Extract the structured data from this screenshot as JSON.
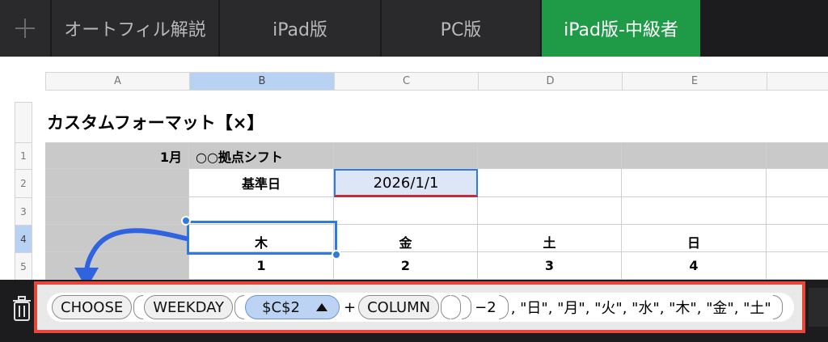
{
  "tabs": [
    {
      "label": "オートフィル解説",
      "active": false
    },
    {
      "label": "iPad版",
      "active": false
    },
    {
      "label": "PC版",
      "active": false
    },
    {
      "label": "iPad版-中級者",
      "active": true
    }
  ],
  "columns": [
    "A",
    "B",
    "C",
    "D",
    "E"
  ],
  "rows": [
    "1",
    "2",
    "3",
    "4",
    "5"
  ],
  "sheet_title": "カスタムフォーマット【×】",
  "cells": {
    "a1": "1月",
    "b1": "○○拠点シフト",
    "b2": "基準日",
    "c2": "2026/1/1",
    "b4": "木",
    "c4": "金",
    "d4": "土",
    "e4": "日",
    "b5": "1",
    "c5": "2",
    "d5": "3",
    "e5": "4"
  },
  "formula": {
    "fn_choose": "CHOOSE",
    "fn_weekday": "WEEKDAY",
    "ref": "$C$2",
    "plus": "+",
    "fn_column": "COLUMN",
    "minus2": "−2",
    "args": ", \"日\", \"月\", \"火\", \"水\", \"木\", \"金\", \"土\""
  },
  "colors": {
    "active_tab": "#1f9a47",
    "selection": "#2f7bdd",
    "highlight_border": "#e8463a",
    "ref_token": "#bcd3f3"
  },
  "icons": [
    "plus-icon",
    "trash-icon",
    "triangle-up-icon",
    "curved-arrow-icon"
  ]
}
